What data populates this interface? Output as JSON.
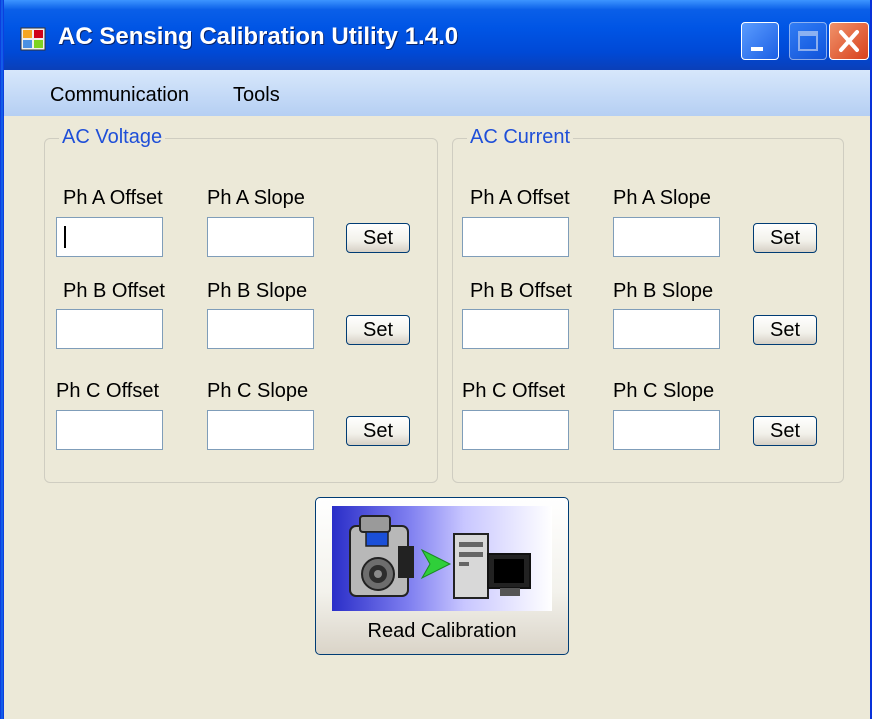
{
  "window": {
    "title": "AC Sensing Calibration Utility 1.4.0"
  },
  "menu": {
    "items": [
      "Communication",
      "Tools"
    ]
  },
  "voltage": {
    "title": "AC Voltage",
    "rows": [
      {
        "offset_label": "Ph A Offset",
        "slope_label": "Ph A Slope",
        "offset_value": "",
        "slope_value": "",
        "set_label": "Set"
      },
      {
        "offset_label": "Ph B Offset",
        "slope_label": "Ph B Slope",
        "offset_value": "",
        "slope_value": "",
        "set_label": "Set"
      },
      {
        "offset_label": "Ph C Offset",
        "slope_label": "Ph C Slope",
        "offset_value": "",
        "slope_value": "",
        "set_label": "Set"
      }
    ]
  },
  "current": {
    "title": "AC Current",
    "rows": [
      {
        "offset_label": "Ph A Offset",
        "slope_label": "Ph A Slope",
        "offset_value": "",
        "slope_value": "",
        "set_label": "Set"
      },
      {
        "offset_label": "Ph B Offset",
        "slope_label": "Ph B Slope",
        "offset_value": "",
        "slope_value": "",
        "set_label": "Set"
      },
      {
        "offset_label": "Ph C Offset",
        "slope_label": "Ph C Slope",
        "offset_value": "",
        "slope_value": "",
        "set_label": "Set"
      }
    ]
  },
  "read_button": {
    "label": "Read Calibration",
    "icon": "camera-to-computer-icon"
  },
  "colors": {
    "titlebar": "#0055e5",
    "group_title": "#1f4fd8",
    "background": "#ece9d8"
  }
}
